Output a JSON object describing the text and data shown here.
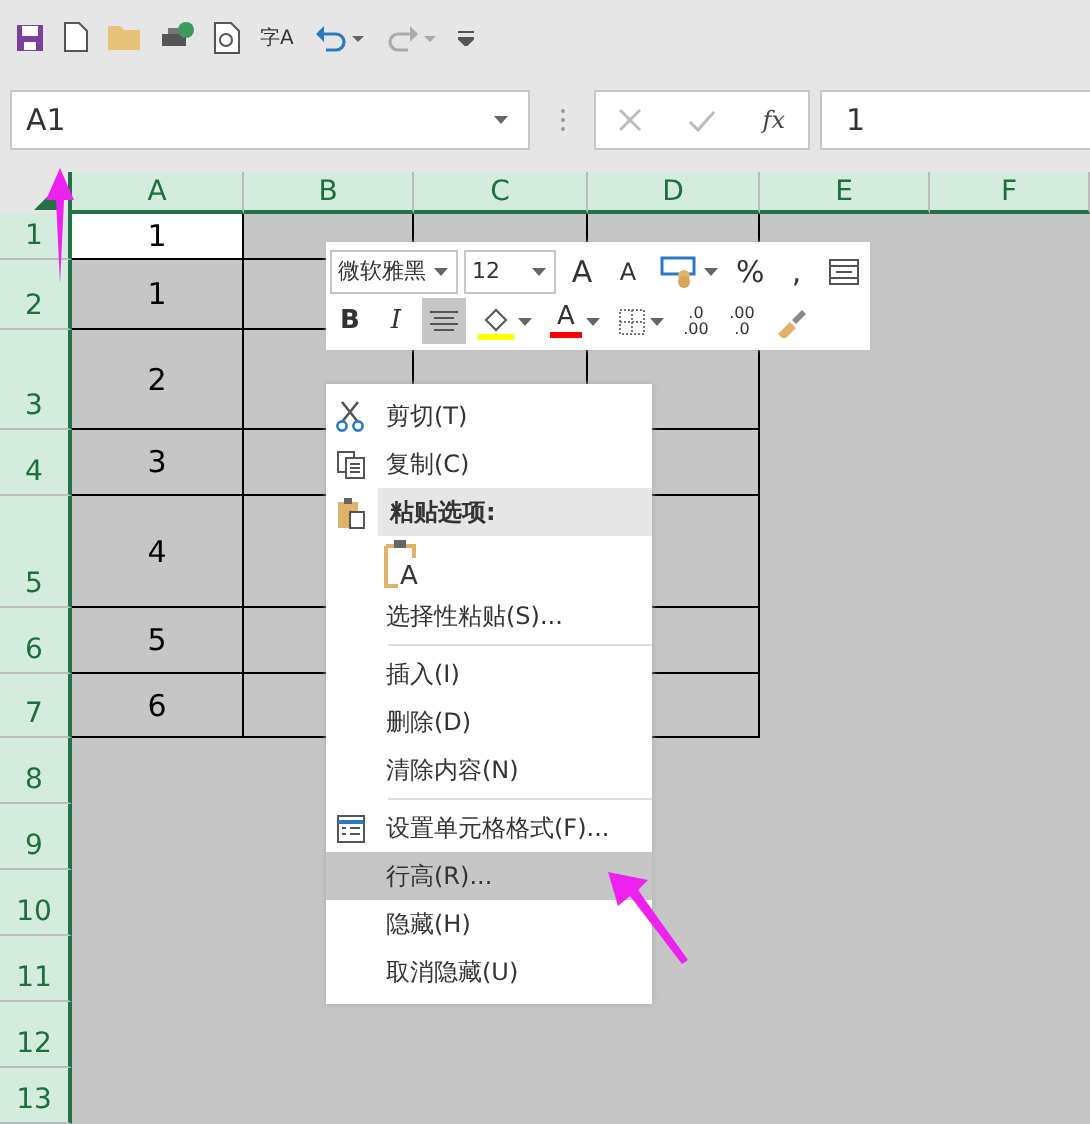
{
  "quick_access": {
    "translate_label": "字A"
  },
  "formula_bar": {
    "name_box": "A1",
    "function_label": "fx",
    "value": "1"
  },
  "columns": [
    {
      "label": "A",
      "selected": true
    },
    {
      "label": "B",
      "selected": true
    },
    {
      "label": "C",
      "selected": true
    },
    {
      "label": "D",
      "selected": true
    },
    {
      "label": "E",
      "selected": true
    },
    {
      "label": "F",
      "selected": true
    }
  ],
  "rows": [
    {
      "label": "1",
      "selected": true,
      "cells": [
        {
          "text": "1",
          "active": true
        },
        {
          "text": "",
          "active": false
        },
        {
          "text": "",
          "active": false
        },
        {
          "text": "",
          "active": false
        }
      ]
    },
    {
      "label": "2",
      "selected": true,
      "cells": [
        {
          "text": "1",
          "active": false
        },
        {
          "text": "",
          "active": false
        },
        {
          "text": ""
        },
        {
          "text": ""
        }
      ]
    },
    {
      "label": "3",
      "selected": true,
      "cells": [
        {
          "text": "2",
          "active": false
        },
        {
          "text": "",
          "active": false
        },
        {
          "text": ""
        },
        {
          "text": "",
          "active": false
        }
      ]
    },
    {
      "label": "4",
      "selected": true,
      "cells": [
        {
          "text": "3",
          "active": false
        },
        {
          "text": "",
          "active": false
        },
        {
          "text": ""
        },
        {
          "text": "",
          "active": false
        }
      ]
    },
    {
      "label": "5",
      "selected": true,
      "cells": [
        {
          "text": "4",
          "active": false
        },
        {
          "text": "",
          "active": false
        },
        {
          "text": ""
        },
        {
          "text": "",
          "active": false
        }
      ]
    },
    {
      "label": "6",
      "selected": true,
      "cells": [
        {
          "text": "5",
          "active": false
        },
        {
          "text": "",
          "active": false
        },
        {
          "text": ""
        },
        {
          "text": "",
          "active": false
        }
      ]
    },
    {
      "label": "7",
      "selected": true,
      "cells": [
        {
          "text": "6",
          "active": false
        },
        {
          "text": "",
          "active": false
        },
        {
          "text": ""
        },
        {
          "text": "",
          "active": false
        }
      ]
    },
    {
      "label": "8",
      "selected": true
    },
    {
      "label": "9",
      "selected": true
    },
    {
      "label": "10",
      "selected": true
    },
    {
      "label": "11",
      "selected": true
    },
    {
      "label": "12",
      "selected": true
    },
    {
      "label": "13",
      "selected": true
    }
  ],
  "mini_toolbar": {
    "font": "微软雅黑",
    "size": "12",
    "row_1": [
      {
        "kind": "grow",
        "label": "A"
      },
      {
        "kind": "shrink",
        "label": "A"
      },
      {
        "kind": "accounting"
      },
      {
        "kind": "text",
        "label": "%"
      },
      {
        "kind": "text",
        "label": ","
      },
      {
        "kind": "wrap"
      }
    ],
    "row_2": [
      {
        "kind": "bold",
        "label": "B",
        "selected": false
      },
      {
        "kind": "italic",
        "label": "I",
        "selected": false
      },
      {
        "kind": "align",
        "selected": true
      },
      {
        "kind": "fill",
        "color": "#ffff00"
      },
      {
        "kind": "font-color",
        "label": "A",
        "color": "#ff0000"
      },
      {
        "kind": "borders"
      },
      {
        "kind": "decimal-up",
        "lines": [
          ".0",
          ".00"
        ]
      },
      {
        "kind": "decimal-down",
        "lines": [
          ".00",
          ".0"
        ]
      },
      {
        "kind": "painter"
      }
    ]
  },
  "context_menu": [
    {
      "kind": "cut",
      "label": "剪切(T)",
      "selected": false
    },
    {
      "kind": "copy",
      "label": "复制(C)",
      "selected": false
    },
    {
      "kind": "paste-heading",
      "label": "粘贴选项:",
      "selected": false
    },
    {
      "kind": "paste-option",
      "label": "A",
      "selected": false
    },
    {
      "kind": "plain",
      "label": "选择性粘贴(S)...",
      "selected": false
    },
    {
      "kind": "divider"
    },
    {
      "kind": "plain",
      "label": "插入(I)",
      "selected": false
    },
    {
      "kind": "plain",
      "label": "删除(D)",
      "selected": false
    },
    {
      "kind": "plain",
      "label": "清除内容(N)",
      "selected": false
    },
    {
      "kind": "divider"
    },
    {
      "kind": "format",
      "label": "设置单元格格式(F)...",
      "selected": false
    },
    {
      "kind": "plain",
      "label": "行高(R)...",
      "selected": true
    },
    {
      "kind": "plain",
      "label": "隐藏(H)",
      "selected": false
    },
    {
      "kind": "plain",
      "label": "取消隐藏(U)",
      "selected": false
    }
  ]
}
